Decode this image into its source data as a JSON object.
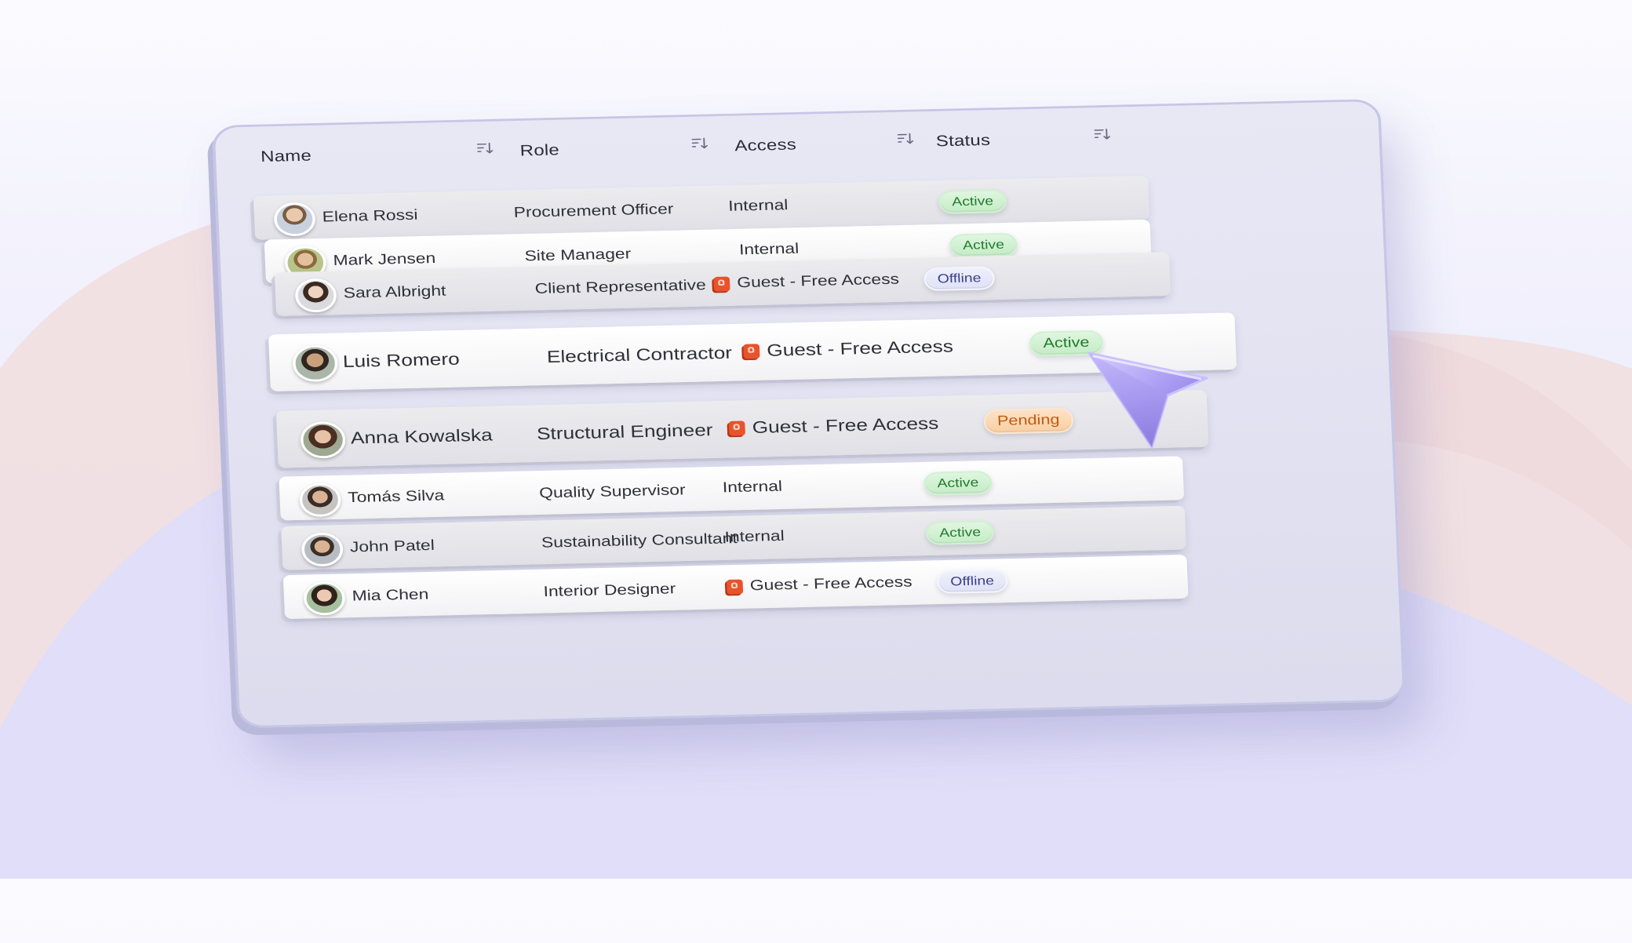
{
  "colors": {
    "active_bg": "#cfeed1",
    "active_text": "#217a2d",
    "offline_bg": "#e3e5f7",
    "offline_text": "#3b3f8c",
    "pending_bg": "#fbd8b4",
    "pending_text": "#c45a0e",
    "guest_lock": "#e8532c",
    "cursor": "#a79cf0"
  },
  "table": {
    "columns": [
      {
        "label": "Name",
        "sort_icon": "sort-icon"
      },
      {
        "label": "Role",
        "sort_icon": "sort-icon"
      },
      {
        "label": "Access",
        "sort_icon": "sort-icon"
      },
      {
        "label": "Status",
        "sort_icon": "sort-icon"
      }
    ],
    "rows": [
      {
        "name": "Elena Rossi",
        "role": "Procurement Officer",
        "access": "Internal",
        "guest": false,
        "status": "Active"
      },
      {
        "name": "Mark Jensen",
        "role": "Site Manager",
        "access": "Internal",
        "guest": false,
        "status": "Active"
      },
      {
        "name": "Sara Albright",
        "role": "Client Representative",
        "access": "Guest - Free Access",
        "guest": true,
        "status": "Offline"
      },
      {
        "name": "Luis Romero",
        "role": "Electrical Contractor",
        "access": "Guest - Free Access",
        "guest": true,
        "status": "Active"
      },
      {
        "name": "Anna Kowalska",
        "role": "Structural Engineer",
        "access": "Guest - Free Access",
        "guest": true,
        "status": "Pending"
      },
      {
        "name": "Tomás Silva",
        "role": "Quality Supervisor",
        "access": "Internal",
        "guest": false,
        "status": "Active"
      },
      {
        "name": "John Patel",
        "role": "Sustainability Consultant",
        "access": "Internal",
        "guest": false,
        "status": "Active"
      },
      {
        "name": "Mia Chen",
        "role": "Interior Designer",
        "access": "Guest - Free Access",
        "guest": true,
        "status": "Offline"
      }
    ]
  }
}
